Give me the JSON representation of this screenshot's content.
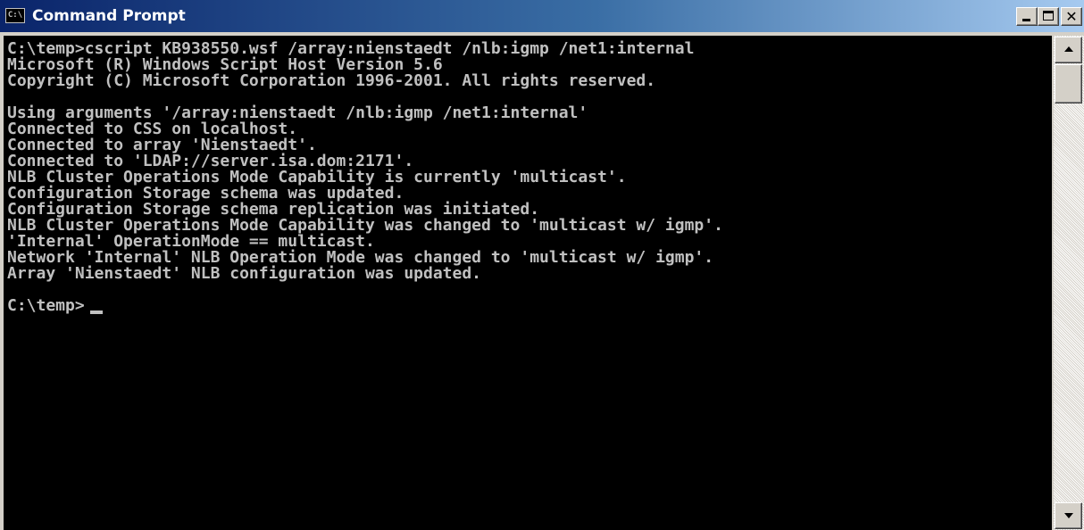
{
  "window": {
    "title": "Command Prompt",
    "icon_glyph": "C:\\"
  },
  "console": {
    "lines": [
      "C:\\temp>cscript KB938550.wsf /array:nienstaedt /nlb:igmp /net1:internal",
      "Microsoft (R) Windows Script Host Version 5.6",
      "Copyright (C) Microsoft Corporation 1996-2001. All rights reserved.",
      "",
      "Using arguments '/array:nienstaedt /nlb:igmp /net1:internal'",
      "Connected to CSS on localhost.",
      "Connected to array 'Nienstaedt'.",
      "Connected to 'LDAP://server.isa.dom:2171'.",
      "NLB Cluster Operations Mode Capability is currently 'multicast'.",
      "Configuration Storage schema was updated.",
      "Configuration Storage schema replication was initiated.",
      "NLB Cluster Operations Mode Capability was changed to 'multicast w/ igmp'.",
      "'Internal' OperationMode == multicast.",
      "Network 'Internal' NLB Operation Mode was changed to 'multicast w/ igmp'.",
      "Array 'Nienstaedt' NLB configuration was updated.",
      "",
      "C:\\temp>"
    ]
  },
  "icons": {
    "app": "command-prompt-icon",
    "minimize": "minimize-icon",
    "maximize": "maximize-icon",
    "close": "close-icon",
    "scroll_up": "scroll-up-arrow-icon",
    "scroll_down": "scroll-down-arrow-icon"
  },
  "colors": {
    "console_bg": "#000000",
    "console_fg": "#c0c0c0",
    "titlebar_start": "#0a246a",
    "titlebar_end": "#a6caf0"
  }
}
